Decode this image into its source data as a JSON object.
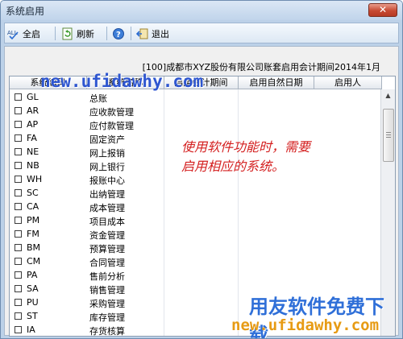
{
  "window": {
    "title": "系统启用",
    "close_glyph": "✕"
  },
  "toolbar": {
    "enable_all_label": "全启",
    "refresh_label": "刷新",
    "exit_label": "退出"
  },
  "header": {
    "info": "[100]成都市XYZ股份有限公司账套启用会计期间2014年1月"
  },
  "table": {
    "columns": [
      "系统编码",
      "系统名称",
      "启用会计期间",
      "启用自然日期",
      "启用人"
    ],
    "rows": [
      {
        "code": "GL",
        "name": "总账"
      },
      {
        "code": "AR",
        "name": "应收款管理"
      },
      {
        "code": "AP",
        "name": "应付款管理"
      },
      {
        "code": "FA",
        "name": "固定资产"
      },
      {
        "code": "NE",
        "name": "网上报销"
      },
      {
        "code": "NB",
        "name": "网上银行"
      },
      {
        "code": "WH",
        "name": "报账中心"
      },
      {
        "code": "SC",
        "name": "出纳管理"
      },
      {
        "code": "CA",
        "name": "成本管理"
      },
      {
        "code": "PM",
        "name": "项目成本"
      },
      {
        "code": "FM",
        "name": "资金管理"
      },
      {
        "code": "BM",
        "name": "预算管理"
      },
      {
        "code": "CM",
        "name": "合同管理"
      },
      {
        "code": "PA",
        "name": "售前分析"
      },
      {
        "code": "SA",
        "name": "销售管理"
      },
      {
        "code": "PU",
        "name": "采购管理"
      },
      {
        "code": "ST",
        "name": "库存管理"
      },
      {
        "code": "IA",
        "name": "存货核算"
      }
    ]
  },
  "overlay": {
    "watermark_url": "new.ufidawhy.com",
    "annotation_line1": "使用软件功能时，需要",
    "annotation_line2": "启用相应的系统。",
    "brand": "用友软件免费下载",
    "brand_url": "new.ufidawhy.com"
  },
  "colors": {
    "annotation": "#d41f1f",
    "watermark_blue": "#2e56d0",
    "brand_orange": "#e79b14"
  }
}
